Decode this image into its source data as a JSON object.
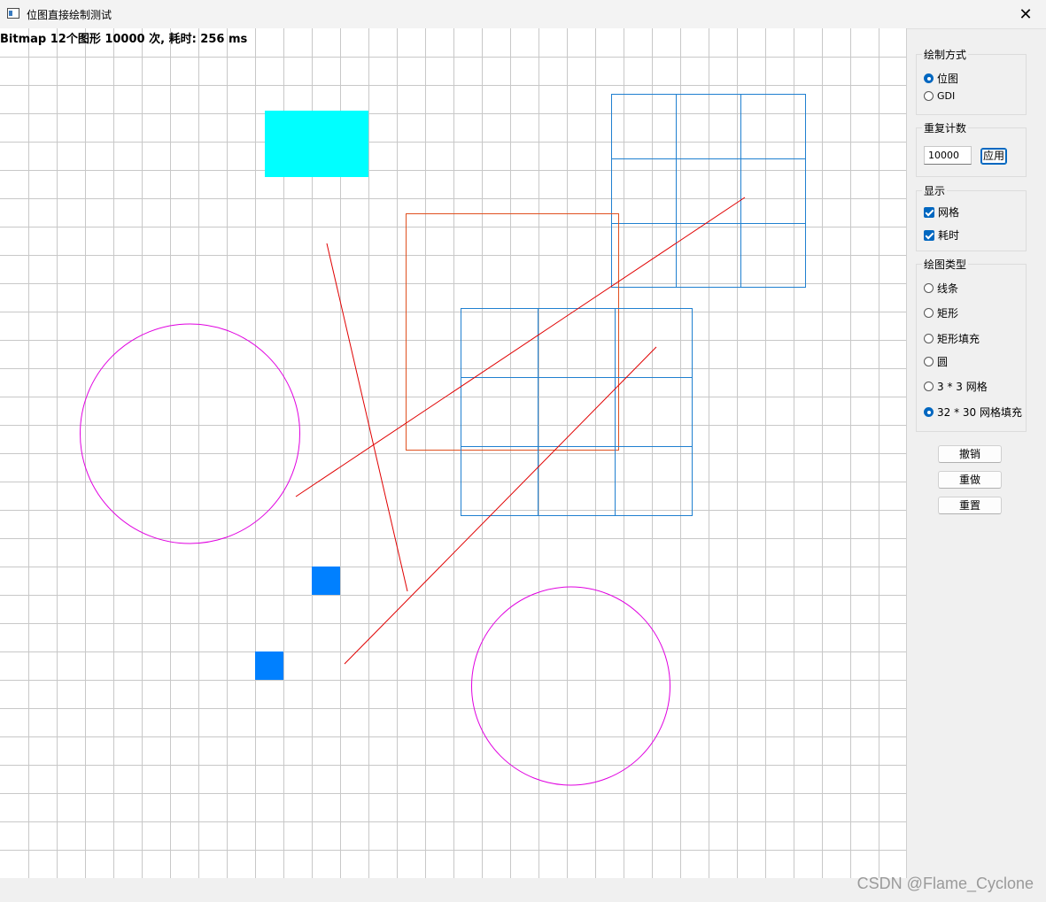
{
  "window": {
    "title": "位图直接绘制测试",
    "close_glyph": "✕",
    "icon": "window-app-icon"
  },
  "canvas": {
    "timing_text": "Bitmap 12个图形 10000 次, 耗时: 256 ms",
    "grid_color": "#c8c8c8"
  },
  "panel": {
    "draw_method": {
      "title": "绘制方式",
      "options": [
        "位图",
        "GDI"
      ],
      "selected": 0
    },
    "repeat": {
      "title": "重复计数",
      "value": "10000",
      "apply_label": "应用"
    },
    "display": {
      "title": "显示",
      "options": [
        "网格",
        "耗时"
      ],
      "checked": [
        true,
        true
      ]
    },
    "shape_type": {
      "title": "绘图类型",
      "options": [
        "线条",
        "矩形",
        "矩形填充",
        "圆",
        "3 * 3 网格",
        "32 * 30 网格填充"
      ],
      "selected": 5
    },
    "actions": [
      "撤销",
      "重做",
      "重置"
    ]
  },
  "colors": {
    "cyan_fill": "#00ffff",
    "blue_fill": "#0080ff",
    "magenta": "#e000e0",
    "red": "#e00000",
    "orange_rect": "#e05020",
    "grid_blue": "#2080d0",
    "accent": "#0067c0"
  },
  "watermark": "CSDN @Flame_Cyclone"
}
